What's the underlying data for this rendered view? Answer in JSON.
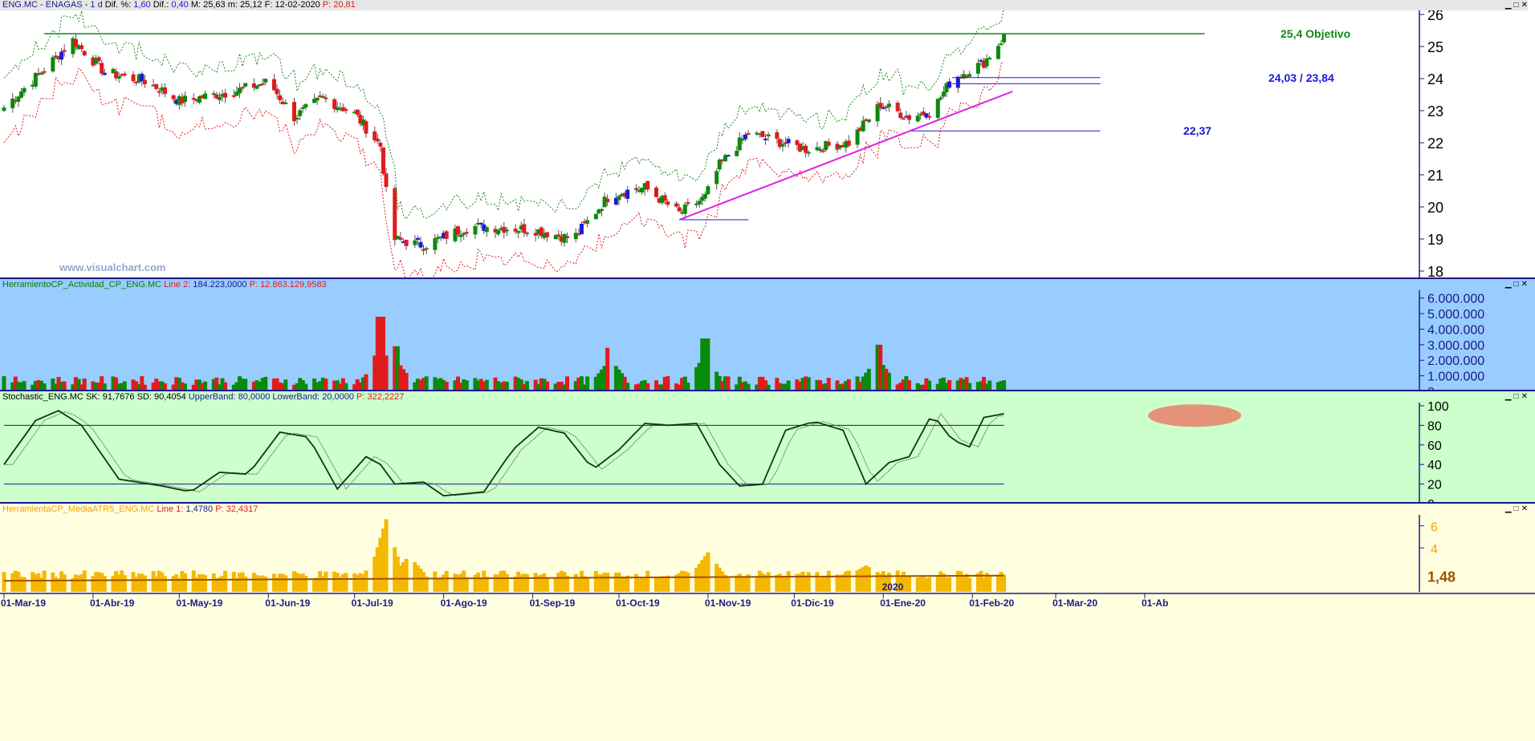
{
  "price_pane": {
    "header": {
      "symbol": "ENG.MC - ENAGAS -",
      "period": "1 d",
      "dif_pct_label": "Dif. %:",
      "dif_pct": "1,60",
      "dif_label": "Dif.:",
      "dif": "0,40",
      "max_label": "M:",
      "max": "25,63",
      "min_label": "m:",
      "min": "25,12",
      "date_label": "F:",
      "date": "12-02-2020",
      "p_label": "P:",
      "p": "20,81"
    },
    "watermark": "www.visualchart.com",
    "annotations": [
      {
        "text": "25,4 Objetivo",
        "value": 25.4,
        "color": "#138a13"
      },
      {
        "text": "24,03 / 23,84",
        "value": 24.03,
        "color": "#1a1ad8"
      },
      {
        "text": "22,37",
        "value": 22.37,
        "color": "#1a1ad8"
      }
    ],
    "y_ticks": [
      "26",
      "25",
      "24",
      "23",
      "22",
      "21",
      "20",
      "19",
      "18"
    ]
  },
  "volume_pane": {
    "header": {
      "name": "HerramientoCP_Actividad_CP_ENG.MC",
      "line_label": "Line 2:",
      "line_value": "184.223,0000",
      "p_label": "P:",
      "p_value": "12.863.129,9583"
    },
    "y_ticks": [
      "6.000.000",
      "5.000.000",
      "4.000.000",
      "3.000.000",
      "2.000.000",
      "1.000.000",
      "0"
    ],
    "bg": "#99ccff"
  },
  "stoch_pane": {
    "header": {
      "name": "Stochastic_ENG.MC",
      "sk_label": "SK:",
      "sk": "91,7676",
      "sd_label": "SD:",
      "sd": "90,4054",
      "ub_label": "UpperBand:",
      "ub": "80,0000",
      "lb_label": "LowerBand:",
      "lb": "20,0000",
      "p_label": "P:",
      "p": "322,2227"
    },
    "y_ticks": [
      "100",
      "80",
      "60",
      "40",
      "20",
      "0"
    ],
    "bg": "#ccffcc"
  },
  "atr_pane": {
    "header": {
      "name": "HerramientaCP_MediaATR5_ENG.MC",
      "line_label": "Line 1:",
      "line_value": "1,4780",
      "p_label": "P:",
      "p_value": "32,4317"
    },
    "y_ticks": [
      "6",
      "4"
    ],
    "last_value": "1,48",
    "bg": "#ffffe0"
  },
  "x_axis": {
    "labels": [
      "01-Mar-19",
      "01-Abr-19",
      "01-May-19",
      "01-Jun-19",
      "01-Jul-19",
      "01-Ago-19",
      "01-Sep-19",
      "01-Oct-19",
      "01-Nov-19",
      "01-Dic-19",
      "01-Ene-20",
      "01-Feb-20",
      "01-Mar-20",
      "01-Ab"
    ],
    "year_marker": "2020"
  },
  "colors": {
    "up": "#0a8a0a",
    "down": "#e01b1b",
    "neutral": "#1a1ad8",
    "target_line": "#138a13",
    "trend_line": "#e020e0",
    "upper_env": "#1a8a1a",
    "lower_env": "#e01b1b",
    "atr_bar": "#f5b800",
    "atr_line": "#a05000",
    "stoch_k": "#0a3a0a",
    "stoch_d": "#6a6a6a",
    "band": "#1a1a8a",
    "axis_text": "#1a1a8a"
  },
  "chart_data": [
    {
      "type": "candlestick",
      "title": "ENG.MC - ENAGAS - 1 d",
      "x_range": [
        "2019-03-01",
        "2020-02-12"
      ],
      "ylim": [
        17.8,
        26.1
      ],
      "close_anchors": [
        {
          "date": "2019-03-01",
          "value": 23.1
        },
        {
          "date": "2019-03-15",
          "value": 24.3
        },
        {
          "date": "2019-03-25",
          "value": 25.2
        },
        {
          "date": "2019-04-05",
          "value": 24.2
        },
        {
          "date": "2019-04-20",
          "value": 23.9
        },
        {
          "date": "2019-05-01",
          "value": 23.3
        },
        {
          "date": "2019-05-20",
          "value": 23.6
        },
        {
          "date": "2019-06-01",
          "value": 23.9
        },
        {
          "date": "2019-06-10",
          "value": 22.8
        },
        {
          "date": "2019-06-20",
          "value": 23.4
        },
        {
          "date": "2019-07-01",
          "value": 22.9
        },
        {
          "date": "2019-07-10",
          "value": 21.9
        },
        {
          "date": "2019-07-14",
          "value": 19.0
        },
        {
          "date": "2019-07-25",
          "value": 18.8
        },
        {
          "date": "2019-08-10",
          "value": 19.4
        },
        {
          "date": "2019-09-01",
          "value": 19.3
        },
        {
          "date": "2019-09-15",
          "value": 19.0
        },
        {
          "date": "2019-09-28",
          "value": 20.4
        },
        {
          "date": "2019-10-10",
          "value": 20.6
        },
        {
          "date": "2019-10-22",
          "value": 19.8
        },
        {
          "date": "2019-10-31",
          "value": 20.3
        },
        {
          "date": "2019-11-05",
          "value": 21.3
        },
        {
          "date": "2019-11-15",
          "value": 22.3
        },
        {
          "date": "2019-12-05",
          "value": 21.8
        },
        {
          "date": "2019-12-20",
          "value": 22.0
        },
        {
          "date": "2019-12-31",
          "value": 23.2
        },
        {
          "date": "2020-01-10",
          "value": 22.8
        },
        {
          "date": "2020-01-18",
          "value": 23.0
        },
        {
          "date": "2020-01-25",
          "value": 24.0
        },
        {
          "date": "2020-02-05",
          "value": 24.5
        },
        {
          "date": "2020-02-12",
          "value": 25.3
        }
      ],
      "lines": [
        {
          "name": "target",
          "value": 25.4,
          "from": "2019-03-15",
          "to": "2020-02-12"
        },
        {
          "name": "support_a",
          "value": 24.03,
          "from": "2020-01-25",
          "to": "2020-02-12"
        },
        {
          "name": "support_b",
          "value": 23.84,
          "from": "2020-01-25",
          "to": "2020-02-12"
        },
        {
          "name": "support_c",
          "value": 22.37,
          "from": "2020-01-10",
          "to": "2020-02-12"
        },
        {
          "name": "swing_low",
          "value": 19.6,
          "from": "2019-10-22",
          "to": "2019-11-15"
        },
        {
          "name": "trendline",
          "from_date": "2019-10-22",
          "from_value": 19.6,
          "to_date": "2020-02-15",
          "to_value": 23.6
        }
      ]
    },
    {
      "type": "bar",
      "name": "Actividad",
      "ylim": [
        0,
        6500000
      ],
      "spikes": [
        {
          "date": "2019-07-10",
          "value": 4800000
        },
        {
          "date": "2019-09-28",
          "value": 2800000
        },
        {
          "date": "2019-10-31",
          "value": 3400000
        },
        {
          "date": "2019-12-30",
          "value": 3000000
        },
        {
          "date": "2019-07-15",
          "value": 2900000
        }
      ],
      "baseline": 700000
    },
    {
      "type": "line",
      "name": "Stochastic",
      "ylim": [
        0,
        100
      ],
      "bands": [
        80,
        20
      ],
      "sk_anchors": [
        {
          "date": "2019-03-01",
          "value": 40
        },
        {
          "date": "2019-03-12",
          "value": 85
        },
        {
          "date": "2019-03-20",
          "value": 95
        },
        {
          "date": "2019-03-28",
          "value": 80
        },
        {
          "date": "2019-04-10",
          "value": 25
        },
        {
          "date": "2019-04-25",
          "value": 18
        },
        {
          "date": "2019-05-05",
          "value": 12
        },
        {
          "date": "2019-05-15",
          "value": 32
        },
        {
          "date": "2019-05-25",
          "value": 30
        },
        {
          "date": "2019-06-05",
          "value": 73
        },
        {
          "date": "2019-06-15",
          "value": 68
        },
        {
          "date": "2019-06-25",
          "value": 15
        },
        {
          "date": "2019-07-05",
          "value": 48
        },
        {
          "date": "2019-07-10",
          "value": 40
        },
        {
          "date": "2019-07-15",
          "value": 20
        },
        {
          "date": "2019-07-25",
          "value": 22
        },
        {
          "date": "2019-08-01",
          "value": 8
        },
        {
          "date": "2019-08-15",
          "value": 12
        },
        {
          "date": "2019-08-25",
          "value": 55
        },
        {
          "date": "2019-09-03",
          "value": 78
        },
        {
          "date": "2019-09-12",
          "value": 72
        },
        {
          "date": "2019-09-22",
          "value": 35
        },
        {
          "date": "2019-10-01",
          "value": 55
        },
        {
          "date": "2019-10-10",
          "value": 82
        },
        {
          "date": "2019-10-18",
          "value": 80
        },
        {
          "date": "2019-10-28",
          "value": 82
        },
        {
          "date": "2019-11-05",
          "value": 40
        },
        {
          "date": "2019-11-12",
          "value": 18
        },
        {
          "date": "2019-11-20",
          "value": 20
        },
        {
          "date": "2019-11-28",
          "value": 75
        },
        {
          "date": "2019-12-08",
          "value": 84
        },
        {
          "date": "2019-12-18",
          "value": 75
        },
        {
          "date": "2019-12-26",
          "value": 20
        },
        {
          "date": "2020-01-03",
          "value": 42
        },
        {
          "date": "2020-01-10",
          "value": 48
        },
        {
          "date": "2020-01-18",
          "value": 92
        },
        {
          "date": "2020-01-25",
          "value": 65
        },
        {
          "date": "2020-01-31",
          "value": 58
        },
        {
          "date": "2020-02-05",
          "value": 88
        },
        {
          "date": "2020-02-12",
          "value": 92
        }
      ]
    },
    {
      "type": "bar",
      "name": "MediaATR5",
      "ylim": [
        0,
        7
      ],
      "spikes": [
        {
          "date": "2019-07-12",
          "value": 6.6
        },
        {
          "date": "2019-07-20",
          "value": 3.3
        },
        {
          "date": "2019-11-01",
          "value": 3.6
        },
        {
          "date": "2019-12-26",
          "value": 2.4
        }
      ],
      "baseline": 1.5,
      "avg_line": {
        "from": 1.0,
        "to": 1.48
      }
    }
  ]
}
